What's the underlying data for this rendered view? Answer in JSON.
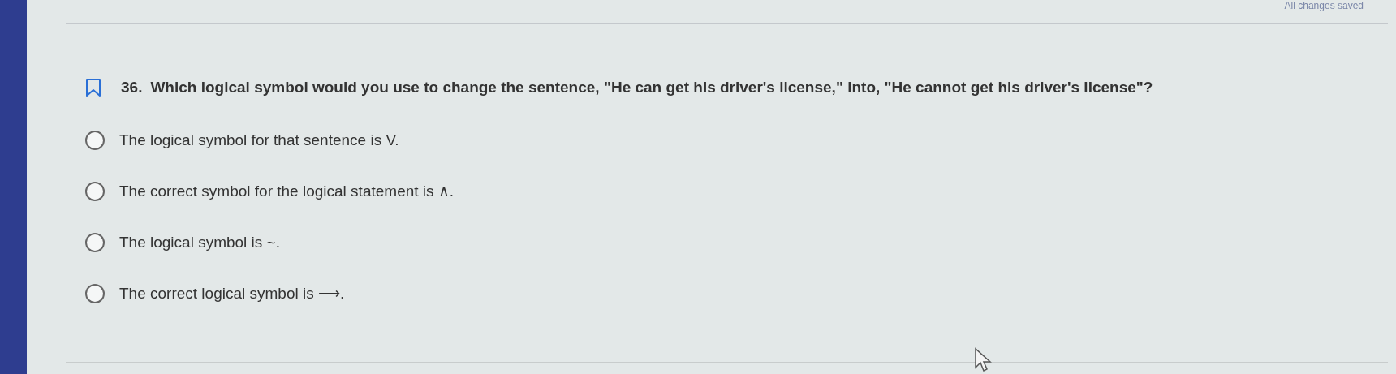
{
  "status": "All changes saved",
  "question": {
    "number": "36.",
    "text": "Which logical symbol would you use to change the sentence, \"He can get his driver's license,\" into, \"He cannot get his driver's license\"?",
    "bookmarked": false
  },
  "options": [
    {
      "label": "The logical symbol for that sentence is V.",
      "selected": false
    },
    {
      "label": "The correct symbol for the logical statement is ∧.",
      "selected": false
    },
    {
      "label": "The logical symbol is ~.",
      "selected": false
    },
    {
      "label": "The correct logical symbol is ⟶.",
      "selected": false
    }
  ]
}
